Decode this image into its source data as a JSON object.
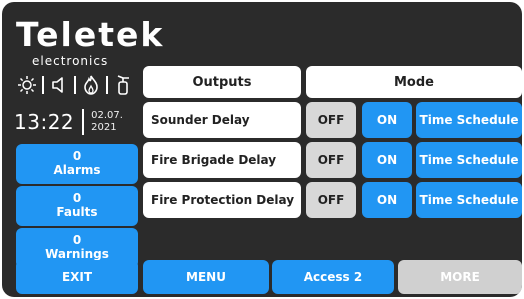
{
  "brand": {
    "name": "Teletek",
    "sub": "electronics"
  },
  "status_icons": [
    "sun-icon",
    "speaker-icon",
    "flame-icon",
    "fire-extinguisher-icon"
  ],
  "clock": {
    "time": "13:22",
    "date_line1": "02.07.",
    "date_line2": "2021"
  },
  "sidebar": {
    "alarms": {
      "count": "0",
      "label": "Alarms"
    },
    "faults": {
      "count": "0",
      "label": "Faults"
    },
    "warnings": {
      "count": "0",
      "label": "Warnings"
    }
  },
  "table": {
    "header_outputs": "Outputs",
    "header_mode": "Mode",
    "rows": [
      {
        "label": "Sounder Delay",
        "off": "OFF",
        "on": "ON",
        "schedule": "Time Schedule"
      },
      {
        "label": "Fire Brigade Delay",
        "off": "OFF",
        "on": "ON",
        "schedule": "Time Schedule"
      },
      {
        "label": "Fire Protection Delay",
        "off": "OFF",
        "on": "ON",
        "schedule": "Time Schedule"
      }
    ]
  },
  "bottom": {
    "exit": "EXIT",
    "menu": "MENU",
    "access": "Access 2",
    "more": "MORE"
  },
  "colors": {
    "background": "#2b2b2b",
    "accent": "#2196f3",
    "off": "#d8d8d8",
    "disabled": "#d0d0d0"
  }
}
